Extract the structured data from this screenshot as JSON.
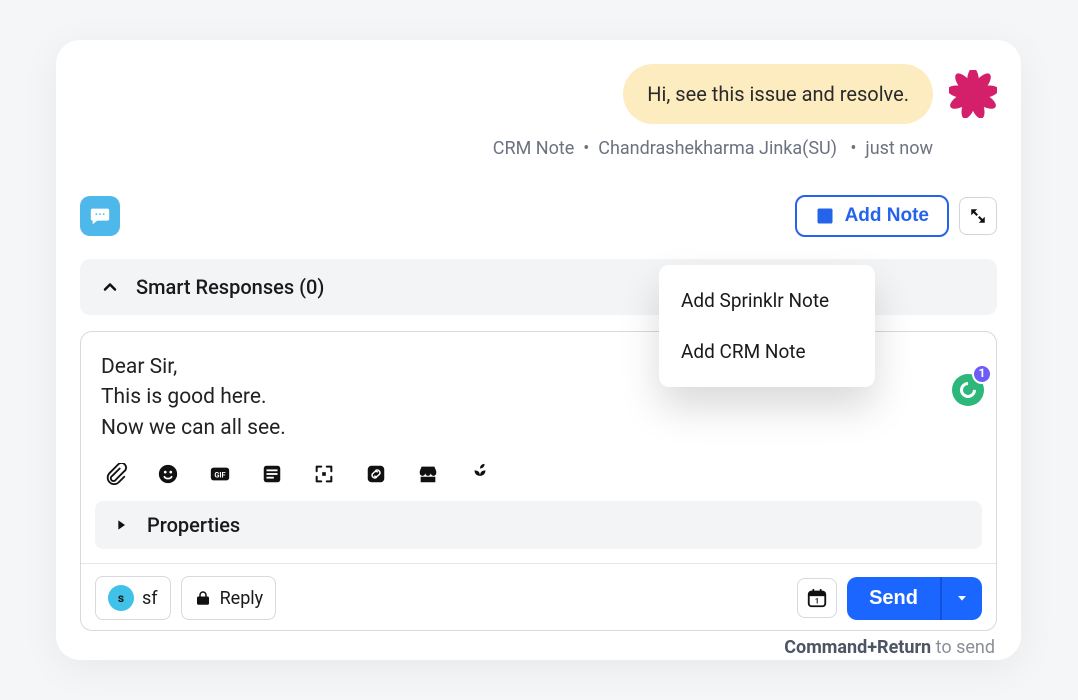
{
  "message": {
    "text": "Hi, see this issue and resolve.",
    "source": "CRM Note",
    "author": "Chandrashekharma Jinka(SU)",
    "time": "just now"
  },
  "add_note": {
    "label": "Add Note",
    "menu": [
      "Add Sprinklr Note",
      "Add CRM Note"
    ]
  },
  "smart_responses": {
    "label": "Smart Responses (0)"
  },
  "compose": {
    "line1": "Dear Sir,",
    "line2": "This is good here.",
    "line3": "Now we can all see.",
    "grammarly_count": "1"
  },
  "properties": {
    "label": "Properties"
  },
  "chips": {
    "sf": "sf",
    "reply": "Reply"
  },
  "send": {
    "label": "Send"
  },
  "hint": {
    "shortcut": "Command+Return",
    "suffix": " to send"
  }
}
